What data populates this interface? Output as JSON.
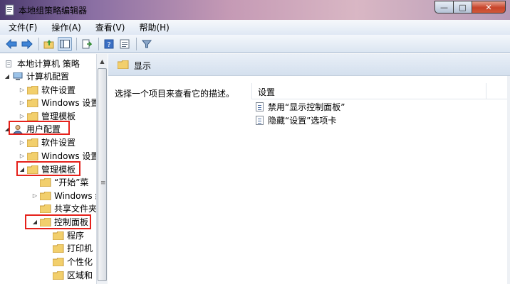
{
  "window": {
    "title": "本地组策略编辑器",
    "controls": {
      "minimize": "—",
      "maximize": "□",
      "close": "✕"
    }
  },
  "menu": [
    "文件(F)",
    "操作(A)",
    "查看(V)",
    "帮助(H)"
  ],
  "toolbar": [
    "back-icon",
    "forward-icon",
    "up-folder-icon",
    "show-hide-tree-icon",
    "export-list-icon",
    "help-icon",
    "properties-icon",
    "filter-icon"
  ],
  "tree": {
    "root": "本地计算机 策略",
    "computer_config": "计算机配置",
    "cc_software": "软件设置",
    "cc_windows": "Windows 设置",
    "cc_admin": "管理模板",
    "user_config": "用户配置",
    "uc_software": "软件设置",
    "uc_windows": "Windows 设置",
    "uc_admin": "管理模板",
    "start_menu": "“开始”菜",
    "windows_comp": "Windows 组",
    "shared_folders": "共享文件夹",
    "control_panel": "控制面板",
    "programs": "程序",
    "printers": "打印机",
    "personalization": "个性化",
    "regional": "区域和"
  },
  "right": {
    "header_title": "显示",
    "description": "选择一个项目来查看它的描述。",
    "column_setting": "设置",
    "settings": [
      "禁用“显示控制面板”",
      "隐藏“设置”选项卡"
    ]
  },
  "colors": {
    "highlight": "#e5211b",
    "folder": "#f2cf6c"
  }
}
